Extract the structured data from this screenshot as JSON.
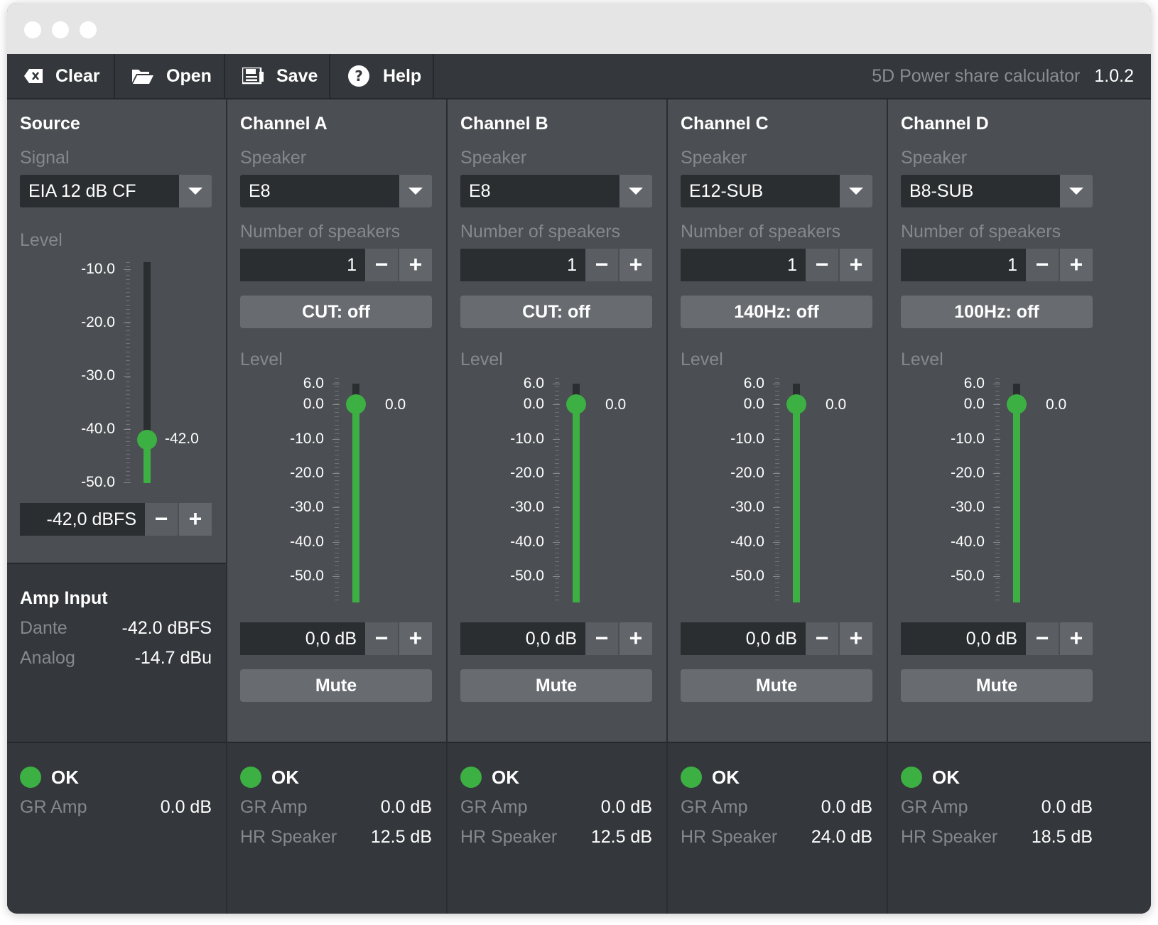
{
  "toolbar": {
    "clear_label": "Clear",
    "open_label": "Open",
    "save_label": "Save",
    "help_label": "Help",
    "app_name": "5D Power share calculator",
    "version": "1.0.2"
  },
  "source": {
    "title": "Source",
    "signal_label": "Signal",
    "signal_value": "EIA 12 dB CF",
    "level_label": "Level",
    "scale": [
      "-10.0",
      "-20.0",
      "-30.0",
      "-40.0",
      "-50.0"
    ],
    "level_readout": "-42.0",
    "level_value_db": -42.0,
    "level_field": "-42,0  dBFS",
    "minus": "−",
    "plus": "+"
  },
  "amp_input": {
    "title": "Amp Input",
    "dante_label": "Dante",
    "dante_value": "-42.0 dBFS",
    "analog_label": "Analog",
    "analog_value": "-14.7 dBu"
  },
  "source_status": {
    "status": "OK",
    "gr_label": "GR Amp",
    "gr_value": "0.0 dB",
    "status_color": "#3cb043"
  },
  "channel_scale": [
    "6.0",
    "0.0",
    "-10.0",
    "-20.0",
    "-30.0",
    "-40.0",
    "-50.0"
  ],
  "channels": [
    {
      "title": "Channel A",
      "speaker_label": "Speaker",
      "speaker": "E8",
      "count_label": "Number of speakers",
      "count": "1",
      "filter": "CUT: off",
      "level_label": "Level",
      "readout": "0.0",
      "level_value_db": 0.0,
      "level_field": "0,0  dB",
      "mute": "Mute",
      "minus": "−",
      "plus": "+",
      "status": "OK",
      "gr_label": "GR Amp",
      "gr_value": "0.0 dB",
      "hr_label": "HR Speaker",
      "hr_value": "12.5 dB"
    },
    {
      "title": "Channel B",
      "speaker_label": "Speaker",
      "speaker": "E8",
      "count_label": "Number of speakers",
      "count": "1",
      "filter": "CUT: off",
      "level_label": "Level",
      "readout": "0.0",
      "level_value_db": 0.0,
      "level_field": "0,0  dB",
      "mute": "Mute",
      "minus": "−",
      "plus": "+",
      "status": "OK",
      "gr_label": "GR Amp",
      "gr_value": "0.0 dB",
      "hr_label": "HR Speaker",
      "hr_value": "12.5 dB"
    },
    {
      "title": "Channel C",
      "speaker_label": "Speaker",
      "speaker": "E12-SUB",
      "count_label": "Number of speakers",
      "count": "1",
      "filter": "140Hz: off",
      "level_label": "Level",
      "readout": "0.0",
      "level_value_db": 0.0,
      "level_field": "0,0  dB",
      "mute": "Mute",
      "minus": "−",
      "plus": "+",
      "status": "OK",
      "gr_label": "GR Amp",
      "gr_value": "0.0 dB",
      "hr_label": "HR Speaker",
      "hr_value": "24.0 dB"
    },
    {
      "title": "Channel D",
      "speaker_label": "Speaker",
      "speaker": "B8-SUB",
      "count_label": "Number of speakers",
      "count": "1",
      "filter": "100Hz: off",
      "level_label": "Level",
      "readout": "0.0",
      "level_value_db": 0.0,
      "level_field": "0,0  dB",
      "mute": "Mute",
      "minus": "−",
      "plus": "+",
      "status": "OK",
      "gr_label": "GR Amp",
      "gr_value": "0.0 dB",
      "hr_label": "HR Speaker",
      "hr_value": "18.5 dB"
    }
  ],
  "colors": {
    "accent_green": "#3cb043",
    "panel": "#4b4e52",
    "dark_panel": "#34373b"
  }
}
